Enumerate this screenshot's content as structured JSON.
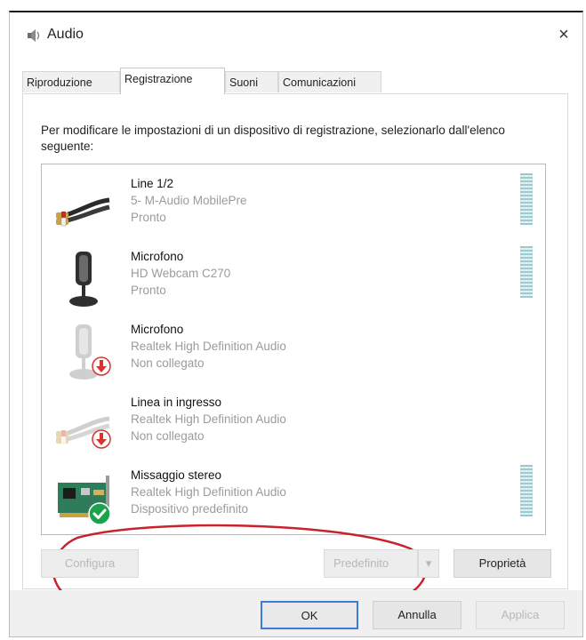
{
  "window": {
    "title": "Audio",
    "close_glyph": "×",
    "icon": "speaker-icon"
  },
  "tabs": [
    {
      "label": "Riproduzione",
      "active": false
    },
    {
      "label": "Registrazione",
      "active": true
    },
    {
      "label": "Suoni",
      "active": false
    },
    {
      "label": "Comunicazioni",
      "active": false
    }
  ],
  "instructions": "Per modificare le impostazioni di un dispositivo di registrazione, selezionarlo dall'elenco seguente:",
  "devices": [
    {
      "name": "Line 1/2",
      "line2": "5- M-Audio MobilePre",
      "status": "Pronto",
      "icon": "line-cable-icon",
      "badge": "none",
      "level_meter": true
    },
    {
      "name": "Microfono",
      "line2": "HD Webcam C270",
      "status": "Pronto",
      "icon": "microphone-icon",
      "badge": "none",
      "level_meter": true
    },
    {
      "name": "Microfono",
      "line2": "Realtek High Definition Audio",
      "status": "Non collegato",
      "icon": "microphone-icon",
      "badge": "unplugged",
      "level_meter": false
    },
    {
      "name": "Linea in ingresso",
      "line2": "Realtek High Definition Audio",
      "status": "Non collegato",
      "icon": "line-cable-icon",
      "badge": "unplugged",
      "level_meter": false
    },
    {
      "name": "Missaggio stereo",
      "line2": "Realtek High Definition Audio",
      "status": "Dispositivo predefinito",
      "icon": "sound-card-icon",
      "badge": "default",
      "level_meter": true
    }
  ],
  "buttons": {
    "configure": "Configura",
    "set_default": "Predefinito",
    "set_default_arrow": "▾",
    "properties": "Proprietà",
    "ok": "OK",
    "cancel": "Annulla",
    "apply": "Applica"
  },
  "colors": {
    "annotation": "#c8232c",
    "default_badge": "#1aa34a",
    "unplugged_badge": "#d9342b",
    "focus_border": "#3d7bd9"
  }
}
